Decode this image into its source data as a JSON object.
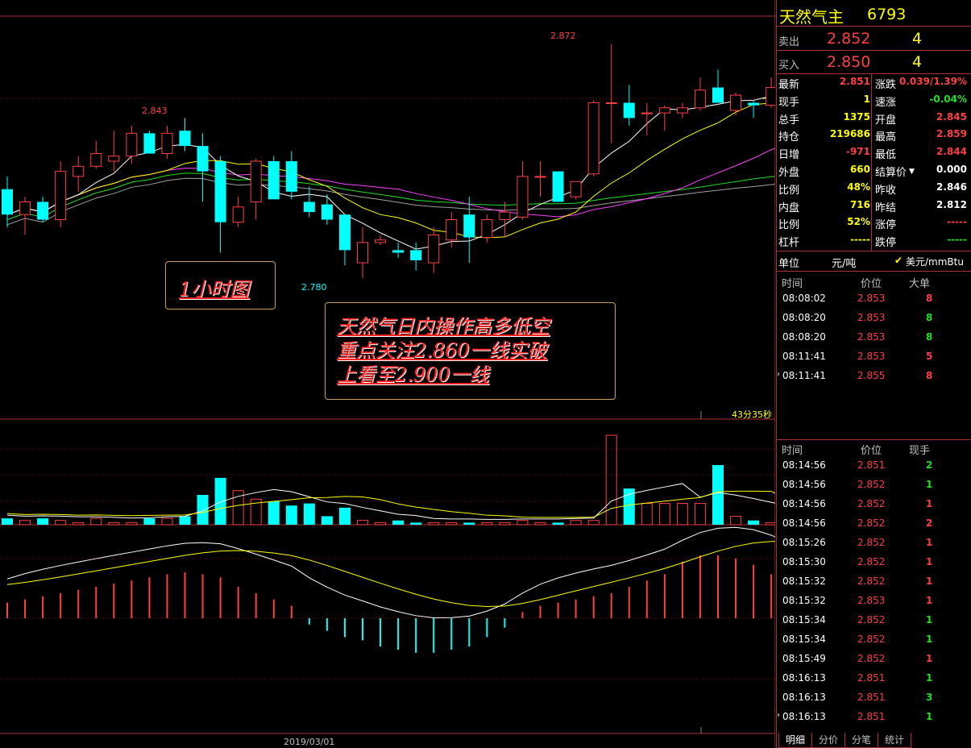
{
  "chart": {
    "price_labels": {
      "high1": "2.843",
      "low1": "2.780",
      "high2": "2.872"
    },
    "timer": "43分35秒",
    "date": "2019/03/01",
    "note1": "1小时图",
    "note2_lines": [
      "天然气日内操作高多低空",
      "重点关注2.860一线实破",
      "上看至2.900一线"
    ],
    "colors": {
      "up": "#ff4040",
      "down": "#00ffff",
      "ma5": "#ffffff",
      "ma10": "#ffff00",
      "ma20": "#ff40ff",
      "ma40": "#20e020",
      "ma60": "#a0a0a0",
      "grid": "#8b0000"
    }
  },
  "chart_data": {
    "type": "candlestick",
    "candles": [
      {
        "o": 2.815,
        "h": 2.82,
        "l": 2.8,
        "c": 2.805
      },
      {
        "o": 2.805,
        "h": 2.812,
        "l": 2.797,
        "c": 2.81
      },
      {
        "o": 2.81,
        "h": 2.812,
        "l": 2.802,
        "c": 2.803
      },
      {
        "o": 2.803,
        "h": 2.826,
        "l": 2.8,
        "c": 2.822
      },
      {
        "o": 2.82,
        "h": 2.828,
        "l": 2.814,
        "c": 2.824
      },
      {
        "o": 2.824,
        "h": 2.834,
        "l": 2.823,
        "c": 2.829
      },
      {
        "o": 2.826,
        "h": 2.838,
        "l": 2.822,
        "c": 2.828
      },
      {
        "o": 2.828,
        "h": 2.84,
        "l": 2.825,
        "c": 2.837
      },
      {
        "o": 2.837,
        "h": 2.838,
        "l": 2.832,
        "c": 2.829
      },
      {
        "o": 2.829,
        "h": 2.84,
        "l": 2.827,
        "c": 2.837
      },
      {
        "o": 2.838,
        "h": 2.843,
        "l": 2.83,
        "c": 2.832
      },
      {
        "o": 2.832,
        "h": 2.837,
        "l": 2.81,
        "c": 2.822
      },
      {
        "o": 2.826,
        "h": 2.828,
        "l": 2.79,
        "c": 2.802
      },
      {
        "o": 2.802,
        "h": 2.812,
        "l": 2.8,
        "c": 2.808
      },
      {
        "o": 2.81,
        "h": 2.827,
        "l": 2.803,
        "c": 2.826
      },
      {
        "o": 2.826,
        "h": 2.828,
        "l": 2.811,
        "c": 2.811
      },
      {
        "o": 2.826,
        "h": 2.83,
        "l": 2.811,
        "c": 2.814
      },
      {
        "o": 2.81,
        "h": 2.816,
        "l": 2.804,
        "c": 2.806
      },
      {
        "o": 2.809,
        "h": 2.813,
        "l": 2.801,
        "c": 2.803
      },
      {
        "o": 2.805,
        "h": 2.805,
        "l": 2.785,
        "c": 2.791
      },
      {
        "o": 2.786,
        "h": 2.8,
        "l": 2.78,
        "c": 2.794
      },
      {
        "o": 2.794,
        "h": 2.797,
        "l": 2.793,
        "c": 2.795
      },
      {
        "o": 2.791,
        "h": 2.794,
        "l": 2.788,
        "c": 2.79
      },
      {
        "o": 2.791,
        "h": 2.794,
        "l": 2.783,
        "c": 2.787
      },
      {
        "o": 2.786,
        "h": 2.8,
        "l": 2.782,
        "c": 2.797
      },
      {
        "o": 2.795,
        "h": 2.806,
        "l": 2.792,
        "c": 2.803
      },
      {
        "o": 2.805,
        "h": 2.812,
        "l": 2.786,
        "c": 2.796
      },
      {
        "o": 2.796,
        "h": 2.805,
        "l": 2.794,
        "c": 2.803
      },
      {
        "o": 2.803,
        "h": 2.81,
        "l": 2.796,
        "c": 2.806
      },
      {
        "o": 2.804,
        "h": 2.826,
        "l": 2.803,
        "c": 2.82
      },
      {
        "o": 2.82,
        "h": 2.826,
        "l": 2.812,
        "c": 2.82
      },
      {
        "o": 2.822,
        "h": 2.822,
        "l": 2.81,
        "c": 2.81
      },
      {
        "o": 2.812,
        "h": 2.818,
        "l": 2.811,
        "c": 2.818
      },
      {
        "o": 2.821,
        "h": 2.85,
        "l": 2.82,
        "c": 2.849
      },
      {
        "o": 2.849,
        "h": 2.872,
        "l": 2.833,
        "c": 2.849
      },
      {
        "o": 2.849,
        "h": 2.856,
        "l": 2.84,
        "c": 2.843
      },
      {
        "o": 2.845,
        "h": 2.849,
        "l": 2.836,
        "c": 2.845
      },
      {
        "o": 2.845,
        "h": 2.848,
        "l": 2.838,
        "c": 2.847
      },
      {
        "o": 2.845,
        "h": 2.849,
        "l": 2.843,
        "c": 2.847
      },
      {
        "o": 2.847,
        "h": 2.859,
        "l": 2.846,
        "c": 2.854
      },
      {
        "o": 2.855,
        "h": 2.862,
        "l": 2.849,
        "c": 2.849
      },
      {
        "o": 2.846,
        "h": 2.853,
        "l": 2.844,
        "c": 2.852
      },
      {
        "o": 2.849,
        "h": 2.85,
        "l": 2.843,
        "c": 2.848
      },
      {
        "o": 2.848,
        "h": 2.859,
        "l": 2.847,
        "c": 2.855
      },
      {
        "o": 2.852,
        "h": 2.854,
        "l": 2.844,
        "c": 2.851
      }
    ],
    "volume": [
      3,
      2,
      3,
      2,
      1,
      3,
      1,
      1,
      3,
      3,
      4,
      14,
      22,
      16,
      12,
      11,
      9,
      10,
      4,
      8,
      2,
      1,
      2,
      1,
      1,
      1,
      1,
      1,
      1,
      2,
      1,
      1,
      2,
      2,
      42,
      17,
      10,
      10,
      10,
      10,
      28,
      4,
      2,
      1,
      1
    ],
    "macd_bars": [
      0.25,
      0.3,
      0.35,
      0.4,
      0.45,
      0.5,
      0.55,
      0.6,
      0.65,
      0.7,
      0.73,
      0.7,
      0.65,
      0.5,
      0.4,
      0.3,
      0.2,
      -0.1,
      -0.2,
      -0.3,
      -0.35,
      -0.45,
      -0.5,
      -0.55,
      -0.55,
      -0.5,
      -0.45,
      -0.3,
      -0.15,
      0.1,
      0.2,
      0.25,
      0.3,
      0.35,
      0.4,
      0.5,
      0.6,
      0.7,
      0.9,
      1.0,
      1.0,
      0.95,
      0.85,
      0.7,
      0.55
    ]
  },
  "quote": {
    "name": "天然气主",
    "code": "6793",
    "sell_label": "卖出",
    "sell_price": "2.852",
    "sell_qty": "4",
    "buy_label": "买入",
    "buy_price": "2.850",
    "buy_qty": "4",
    "left": [
      {
        "k": "最新",
        "v": "2.851",
        "c": "red"
      },
      {
        "k": "现手",
        "v": "1",
        "c": "yellow"
      },
      {
        "k": "总手",
        "v": "1375",
        "c": "yellow"
      },
      {
        "k": "持仓",
        "v": "219686",
        "c": "yellow"
      },
      {
        "k": "日增",
        "v": "-971",
        "c": "red"
      },
      {
        "k": "外盘",
        "v": "660",
        "c": "yellow"
      },
      {
        "k": "比例",
        "v": "48%",
        "c": "yellow"
      },
      {
        "k": "内盘",
        "v": "716",
        "c": "yellow"
      },
      {
        "k": "比例",
        "v": "52%",
        "c": "yellow"
      },
      {
        "k": "杠杆",
        "v": "-----",
        "c": "yellow"
      }
    ],
    "right": [
      {
        "k": "涨跌",
        "v": "0.039/1.39%",
        "c": "red"
      },
      {
        "k": "速涨",
        "v": "-0.04%",
        "c": "green"
      },
      {
        "k": "开盘",
        "v": "2.845",
        "c": "red"
      },
      {
        "k": "最高",
        "v": "2.859",
        "c": "red"
      },
      {
        "k": "最低",
        "v": "2.844",
        "c": "red"
      },
      {
        "k": "结算价",
        "v": "0.000",
        "c": "white"
      },
      {
        "k": "昨收",
        "v": "2.846",
        "c": "white"
      },
      {
        "k": "昨结",
        "v": "2.812",
        "c": "white"
      },
      {
        "k": "涨停",
        "v": "-----",
        "c": "red"
      },
      {
        "k": "跌停",
        "v": "-----",
        "c": "green"
      }
    ],
    "unit_label": "单位",
    "unit_value": "元/吨",
    "unit_check": "美元/mmBtu"
  },
  "big_trades": {
    "headers": [
      "时间",
      "价位",
      "大单"
    ],
    "rows": [
      {
        "t": "08:08:02",
        "p": "2.853",
        "q": "8",
        "qc": "red"
      },
      {
        "t": "08:08:20",
        "p": "2.853",
        "q": "8",
        "qc": "green"
      },
      {
        "t": "08:08:20",
        "p": "2.853",
        "q": "8",
        "qc": "green"
      },
      {
        "t": "08:11:41",
        "p": "2.853",
        "q": "5",
        "qc": "red"
      },
      {
        "t": "08:11:41",
        "p": "2.855",
        "q": "8",
        "qc": "red"
      }
    ]
  },
  "ticks": {
    "headers": [
      "时间",
      "价位",
      "现手"
    ],
    "rows": [
      {
        "t": "08:14:56",
        "p": "2.851",
        "q": "2",
        "qc": "green"
      },
      {
        "t": "08:14:56",
        "p": "2.852",
        "q": "1",
        "qc": "green"
      },
      {
        "t": "08:14:56",
        "p": "2.852",
        "q": "1",
        "qc": "red"
      },
      {
        "t": "08:14:56",
        "p": "2.852",
        "q": "2",
        "qc": "red"
      },
      {
        "t": "08:15:26",
        "p": "2.852",
        "q": "1",
        "qc": "red"
      },
      {
        "t": "08:15:30",
        "p": "2.852",
        "q": "1",
        "qc": "red"
      },
      {
        "t": "08:15:32",
        "p": "2.852",
        "q": "1",
        "qc": "red"
      },
      {
        "t": "08:15:32",
        "p": "2.853",
        "q": "1",
        "qc": "red"
      },
      {
        "t": "08:15:34",
        "p": "2.852",
        "q": "1",
        "qc": "green"
      },
      {
        "t": "08:15:34",
        "p": "2.852",
        "q": "1",
        "qc": "green"
      },
      {
        "t": "08:15:49",
        "p": "2.852",
        "q": "1",
        "qc": "red"
      },
      {
        "t": "08:16:13",
        "p": "2.851",
        "q": "1",
        "qc": "green"
      },
      {
        "t": "08:16:13",
        "p": "2.851",
        "q": "3",
        "qc": "green"
      },
      {
        "t": "08:16:13",
        "p": "2.851",
        "q": "1",
        "qc": "green"
      }
    ]
  },
  "tabs": [
    "明细",
    "分价",
    "分笔",
    "统计"
  ]
}
